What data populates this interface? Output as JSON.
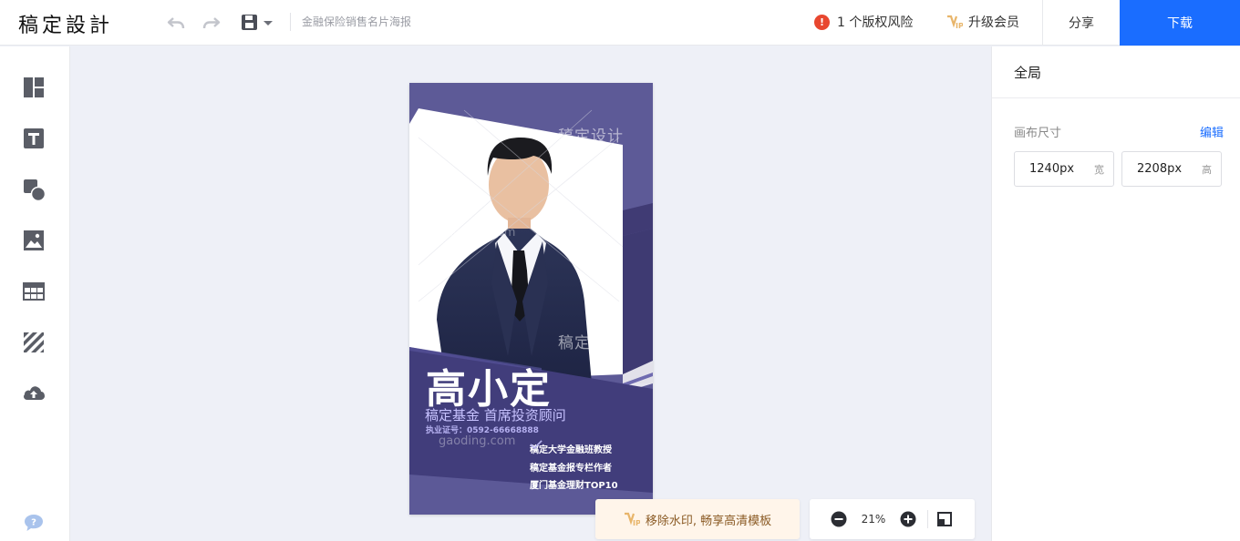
{
  "app": {
    "logo": "稿定設計",
    "doc_title": "金融保险销售名片海报"
  },
  "toolbar": {
    "undo_icon": "undo-icon",
    "redo_icon": "redo-icon",
    "save_icon": "save-icon",
    "risk_count_label": "1 个版权风险",
    "upgrade_label": "升级会员",
    "share_label": "分享",
    "download_label": "下载",
    "accent_color": "#1a6dff"
  },
  "rail": {
    "items": [
      "layout-icon",
      "text-icon",
      "shape-icon",
      "image-icon",
      "table-icon",
      "texture-icon",
      "upload-icon"
    ],
    "help_icon": "help-icon"
  },
  "panel": {
    "title": "全局",
    "size_label": "画布尺寸",
    "edit_label": "编辑",
    "width_value": "1240px",
    "width_unit": "宽",
    "height_value": "2208px",
    "height_unit": "高"
  },
  "poster": {
    "name": "高小定",
    "subtitle": "稿定基金 首席投资顾问",
    "license": "执业证号：0592-66668888",
    "watermark_brand": "稿定设计",
    "watermark_url": "gaoding.com",
    "bullets": [
      "稿定大学金融班教授",
      "稿定基金报专栏作者",
      "厦门基金理财TOP10"
    ]
  },
  "bottom": {
    "watermark_promo": "移除水印, 畅享高清模板",
    "zoom": "21%"
  }
}
